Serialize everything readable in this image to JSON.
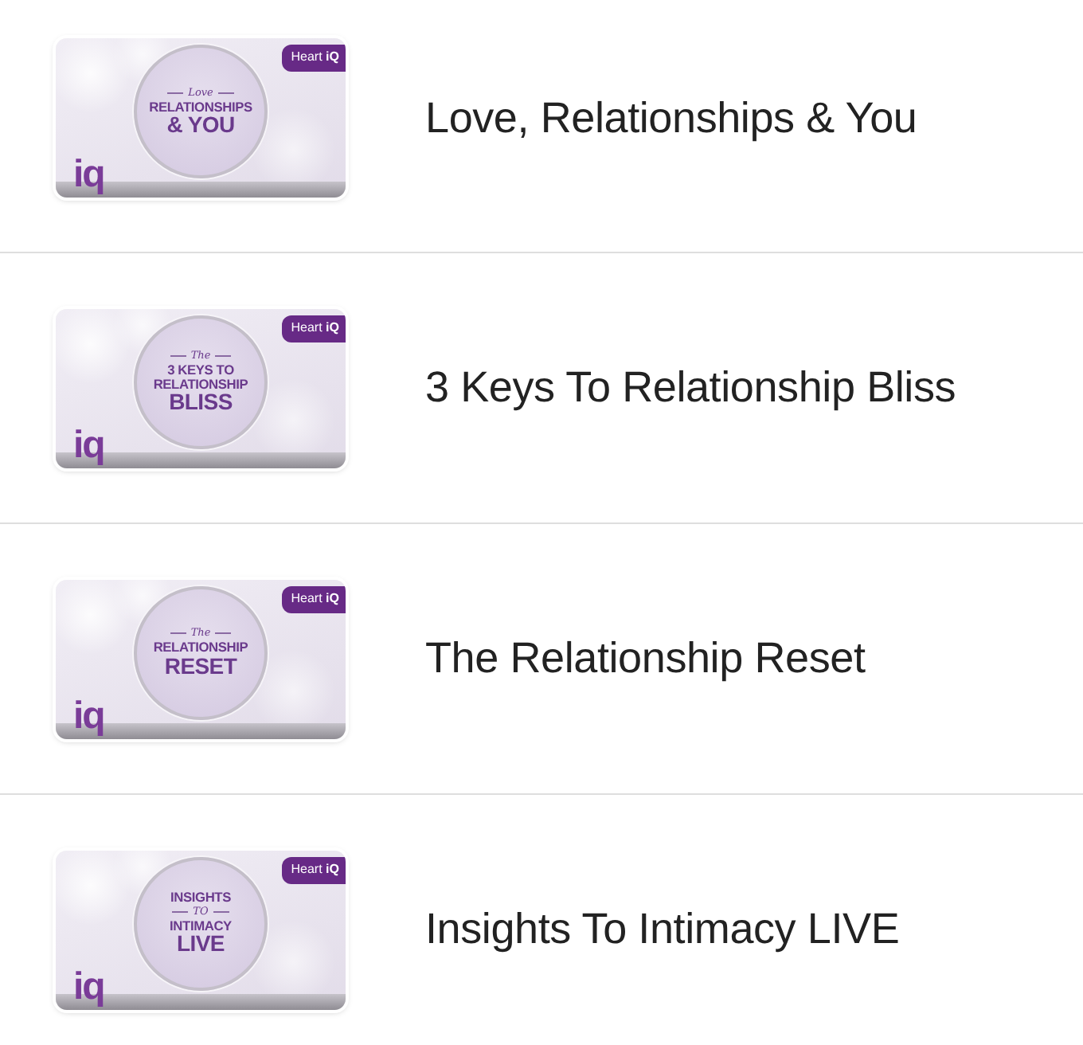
{
  "courses": [
    {
      "title": "Love, Relationships & You",
      "thumbnail": {
        "badge": "Heart **iQ**",
        "logo": "iq",
        "lines": [
          {
            "kind": "script",
            "text": "Love"
          },
          {
            "kind": "caps",
            "text": "RELATIONSHIPS"
          },
          {
            "kind": "large",
            "text": "& YOU"
          }
        ]
      }
    },
    {
      "title": "3 Keys To Relationship Bliss",
      "thumbnail": {
        "badge": "Heart **iQ**",
        "logo": "iq",
        "lines": [
          {
            "kind": "script",
            "text": "The"
          },
          {
            "kind": "caps",
            "text": "3 KEYS TO"
          },
          {
            "kind": "caps",
            "text": "RELATIONSHIP"
          },
          {
            "kind": "large",
            "text": "BLISS"
          }
        ]
      }
    },
    {
      "title": "The Relationship Reset",
      "thumbnail": {
        "badge": "Heart **iQ**",
        "logo": "iq",
        "lines": [
          {
            "kind": "script",
            "text": "The"
          },
          {
            "kind": "caps",
            "text": "RELATIONSHIP"
          },
          {
            "kind": "large",
            "text": "RESET"
          }
        ]
      }
    },
    {
      "title": "Insights To Intimacy LIVE",
      "thumbnail": {
        "badge": "Heart **iQ**",
        "logo": "iq",
        "lines": [
          {
            "kind": "caps",
            "text": "INSIGHTS"
          },
          {
            "kind": "script",
            "text": "TO"
          },
          {
            "kind": "caps",
            "text": "INTIMACY"
          },
          {
            "kind": "large",
            "text": "LIVE"
          }
        ]
      }
    }
  ]
}
